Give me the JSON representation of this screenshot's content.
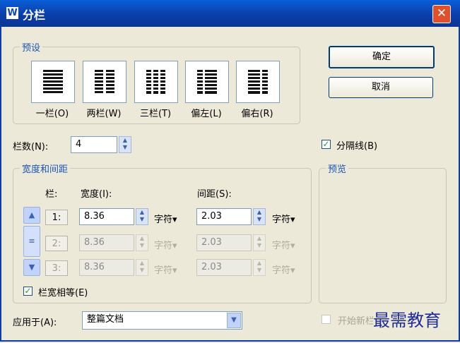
{
  "window": {
    "title": "分栏",
    "icon": "W",
    "close": "✕"
  },
  "presets": {
    "legend": "预设",
    "items": [
      {
        "label": "一栏(O)",
        "icon": "one-column-icon",
        "columns": 1
      },
      {
        "label": "两栏(W)",
        "icon": "two-column-icon",
        "columns": 2
      },
      {
        "label": "三栏(T)",
        "icon": "three-column-icon",
        "columns": 3
      },
      {
        "label": "偏左(L)",
        "icon": "left-column-icon",
        "columns": 2
      },
      {
        "label": "偏右(R)",
        "icon": "right-column-icon",
        "columns": 2
      }
    ]
  },
  "buttons": {
    "ok": "确定",
    "cancel": "取消"
  },
  "column_count": {
    "label": "栏数(N):",
    "value": "4"
  },
  "divider": {
    "label": "分隔线(B)",
    "checked": "✓"
  },
  "width_spacing": {
    "legend": "宽度和间距",
    "col_header": "栏:",
    "width_header": "宽度(I):",
    "spacing_header": "间距(S):",
    "rows": [
      {
        "num": "1:",
        "width": "8.36",
        "width_unit": "字符",
        "spacing": "2.03",
        "spacing_unit": "字符"
      },
      {
        "num": "2:",
        "width": "8.36",
        "width_unit": "字符",
        "spacing": "2.03",
        "spacing_unit": "字符"
      },
      {
        "num": "3:",
        "width": "8.36",
        "width_unit": "字符",
        "spacing": "2.03",
        "spacing_unit": "字符"
      }
    ],
    "equal_width": {
      "label": "栏宽相等(E)",
      "checked": "✓"
    }
  },
  "preview": {
    "legend": "预览"
  },
  "apply_to": {
    "label": "应用于(A):",
    "value": "整篇文档"
  },
  "new_column": {
    "label": "开始新栏"
  },
  "watermark": "最需教育",
  "icons": {
    "spin_up": "▲",
    "spin_down": "▼",
    "dropdown": "▾",
    "scroll_up": "▲",
    "scroll_down": "▼",
    "scroll_thumb": "≡"
  }
}
